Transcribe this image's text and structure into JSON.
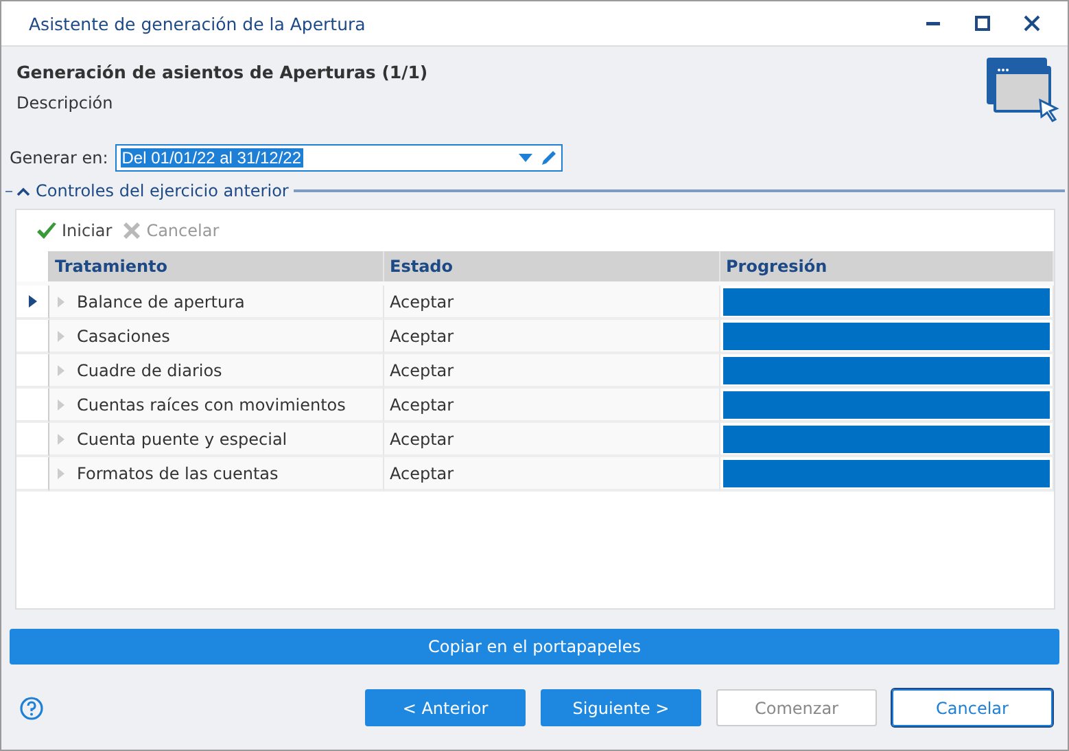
{
  "window": {
    "title": "Asistente de generación de la Apertura"
  },
  "header": {
    "title": "Generación de asientos de Aperturas (1/1)",
    "description": "Descripción"
  },
  "period": {
    "label": "Generar en:",
    "value": "Del 01/01/22 al 31/12/22"
  },
  "section": {
    "title": "Controles del ejercicio anterior",
    "expanded": true
  },
  "toolbar": [
    {
      "kind": "start",
      "label": "Iniciar",
      "disabled": false
    },
    {
      "kind": "cancel",
      "label": "Cancelar",
      "disabled": true
    }
  ],
  "table": {
    "columns": [
      "Tratamiento",
      "Estado",
      "Progresión"
    ],
    "rows": [
      {
        "name": "Balance de apertura",
        "status": "Aceptar",
        "level": 1,
        "selected": true
      },
      {
        "name": "Casaciones",
        "status": "Aceptar",
        "level": 1,
        "selected": false
      },
      {
        "name": "Cuadre de diarios",
        "status": "Aceptar",
        "level": 1,
        "selected": false
      },
      {
        "name": "Cuentas raíces con movimientos",
        "status": "Aceptar",
        "level": 1,
        "selected": false
      },
      {
        "name": "Cuenta puente y especial",
        "status": "Aceptar",
        "level": 1,
        "selected": false
      },
      {
        "name": "Formatos de las cuentas",
        "status": "Aceptar",
        "level": 1,
        "selected": false
      }
    ]
  },
  "copy_button": "Copiar en el portapapeles",
  "buttons": [
    {
      "label": "< Anterior",
      "kind": "primary",
      "disabled": false
    },
    {
      "label": "Siguiente >",
      "kind": "primary",
      "disabled": false
    },
    {
      "label": "Comenzar",
      "kind": "plain",
      "disabled": true
    },
    {
      "label": "Cancelar",
      "kind": "focused",
      "disabled": false
    }
  ]
}
